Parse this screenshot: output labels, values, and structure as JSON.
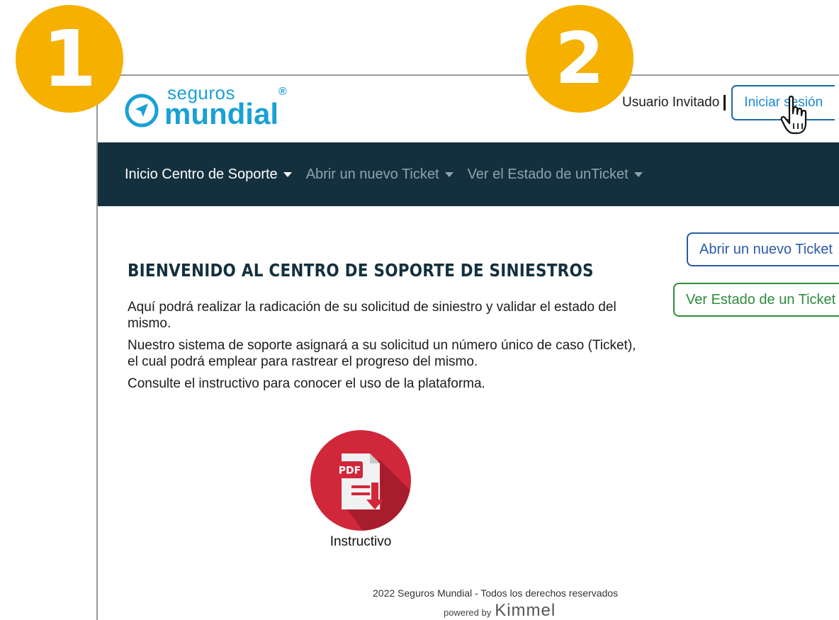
{
  "steps": {
    "one": "1",
    "two": "2"
  },
  "header": {
    "logo_top": "seguros",
    "logo_bottom": "mundial",
    "logo_reg": "®",
    "guest_label": "Usuario Invitado",
    "login_label": "Iniciar sesión"
  },
  "nav": {
    "items": [
      {
        "label": "Inicio Centro de Soporte"
      },
      {
        "label": "Abrir un nuevo Ticket"
      },
      {
        "label": "Ver el Estado de unTicket"
      }
    ]
  },
  "main": {
    "title": "BIENVENIDO AL CENTRO DE SOPORTE DE SINIESTROS",
    "paragraphs": [
      "Aquí podrá realizar la radicación de su solicitud de siniestro y validar el estado del mismo.",
      "Nuestro sistema de soporte asignará a su solicitud un número único de caso (Ticket), el cual podrá emplear para rastrear el progreso del mismo.",
      "Consulte el instructivo para conocer el uso de la plataforma."
    ],
    "new_ticket_button": "Abrir un nuevo Ticket",
    "status_button": "Ver Estado de un Ticket",
    "pdf_badge": "PDF",
    "pdf_label": "Instructivo"
  },
  "footer": {
    "copyright": "2022 Seguros Mundial - Todos los derechos reservados",
    "powered_label": "powered by",
    "powered_brand": "Kimmel"
  },
  "colors": {
    "navbar": "#14303f",
    "accent_blue": "#1aa0d6",
    "step_circle": "#f5b000",
    "pdf_red": "#d0273a",
    "status_green": "#2e8b3a"
  },
  "icons": {
    "logo": "navigation-arrow-icon",
    "cursor": "hand-pointer-icon",
    "pdf": "pdf-download-icon"
  }
}
